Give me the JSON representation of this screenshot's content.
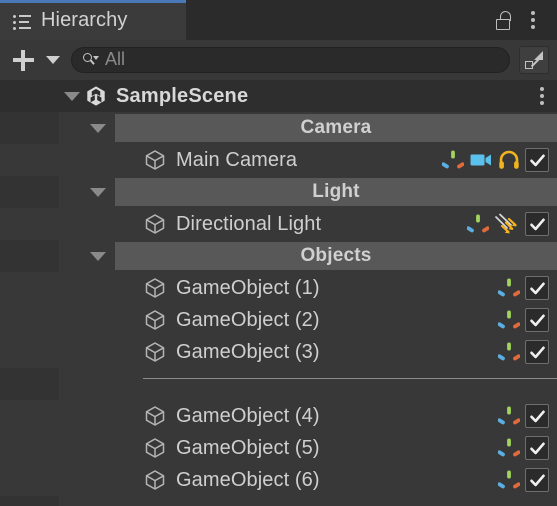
{
  "window": {
    "tab_label": "Hierarchy",
    "tab_icon": "hierarchy-list-icon",
    "lock_icon": "unlocked-padlock-icon",
    "menu_icon": "kebab-menu-icon"
  },
  "toolbar": {
    "add_label": "+",
    "add_icon": "plus-icon",
    "add_dropdown_icon": "chevron-down-icon",
    "search": {
      "icon": "search-icon",
      "value": "All",
      "placeholder": "All"
    },
    "expand_icon": "expand-window-icon"
  },
  "tree": {
    "scene": {
      "name": "SampleScene",
      "icon": "unity-scene-icon",
      "expanded": true,
      "foldout_icon": "triangle-down-icon",
      "menu_icon": "kebab-menu-icon"
    },
    "sections": [
      {
        "title": "Camera",
        "expanded": true,
        "items": [
          {
            "name": "Main Camera",
            "icon": "cube-icon",
            "badges": [
              "axis-gizmo-icon",
              "video-camera-icon",
              "headphones-icon"
            ],
            "enabled": true
          }
        ]
      },
      {
        "title": "Light",
        "expanded": true,
        "items": [
          {
            "name": "Directional Light",
            "icon": "cube-icon",
            "badges": [
              "axis-gizmo-icon",
              "directional-light-icon"
            ],
            "enabled": true
          }
        ]
      },
      {
        "title": "Objects",
        "expanded": true,
        "items": [
          {
            "name": "GameObject (1)",
            "icon": "cube-icon",
            "badges": [
              "axis-gizmo-icon"
            ],
            "enabled": true
          },
          {
            "name": "GameObject (2)",
            "icon": "cube-icon",
            "badges": [
              "axis-gizmo-icon"
            ],
            "enabled": true
          },
          {
            "name": "GameObject (3)",
            "icon": "cube-icon",
            "badges": [
              "axis-gizmo-icon"
            ],
            "enabled": true
          },
          {
            "separator": true
          },
          {
            "name": "GameObject (4)",
            "icon": "cube-icon",
            "badges": [
              "axis-gizmo-icon"
            ],
            "enabled": true
          },
          {
            "name": "GameObject (5)",
            "icon": "cube-icon",
            "badges": [
              "axis-gizmo-icon"
            ],
            "enabled": true
          },
          {
            "name": "GameObject (6)",
            "icon": "cube-icon",
            "badges": [
              "axis-gizmo-icon"
            ],
            "enabled": true
          }
        ]
      }
    ]
  },
  "colors": {
    "panel_bg": "#383838",
    "tabbar_bg": "#2b2b2b",
    "tab_active_bg": "#3b3b3b",
    "tab_accent": "#4a78b8",
    "scene_row_bg": "#2e2e2e",
    "section_bar_bg": "#585858",
    "text": "#cfcfcf",
    "gizmo_green": "#a2d45e",
    "gizmo_blue": "#5aaee0",
    "gizmo_red": "#e06a3c",
    "camera_blue": "#5cc0ec",
    "audio_yellow": "#f0b41e",
    "light_yellow": "#f5b41e"
  }
}
